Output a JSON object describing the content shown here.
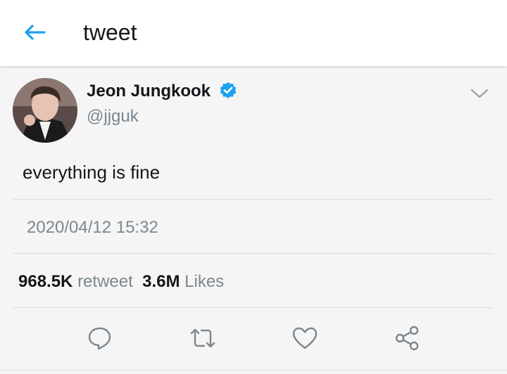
{
  "header": {
    "title": "tweet",
    "back_icon": "arrow-left-icon",
    "accent_color": "#1da1f2"
  },
  "tweet": {
    "author": {
      "display_name": "Jeon Jungkook",
      "handle": "@jjguk",
      "verified": true,
      "verified_icon": "verified-badge-icon"
    },
    "text": "everything is fine",
    "timestamp": "2020/04/12 15:32",
    "stats": {
      "retweets": "968.5K",
      "retweet_label": "retweet",
      "likes": "3.6M",
      "likes_label": "Likes"
    },
    "actions": [
      {
        "name": "reply",
        "icon": "reply-icon"
      },
      {
        "name": "retweet",
        "icon": "retweet-icon"
      },
      {
        "name": "like",
        "icon": "heart-icon"
      },
      {
        "name": "share",
        "icon": "share-icon"
      }
    ],
    "menu_icon": "chevron-down-icon"
  }
}
